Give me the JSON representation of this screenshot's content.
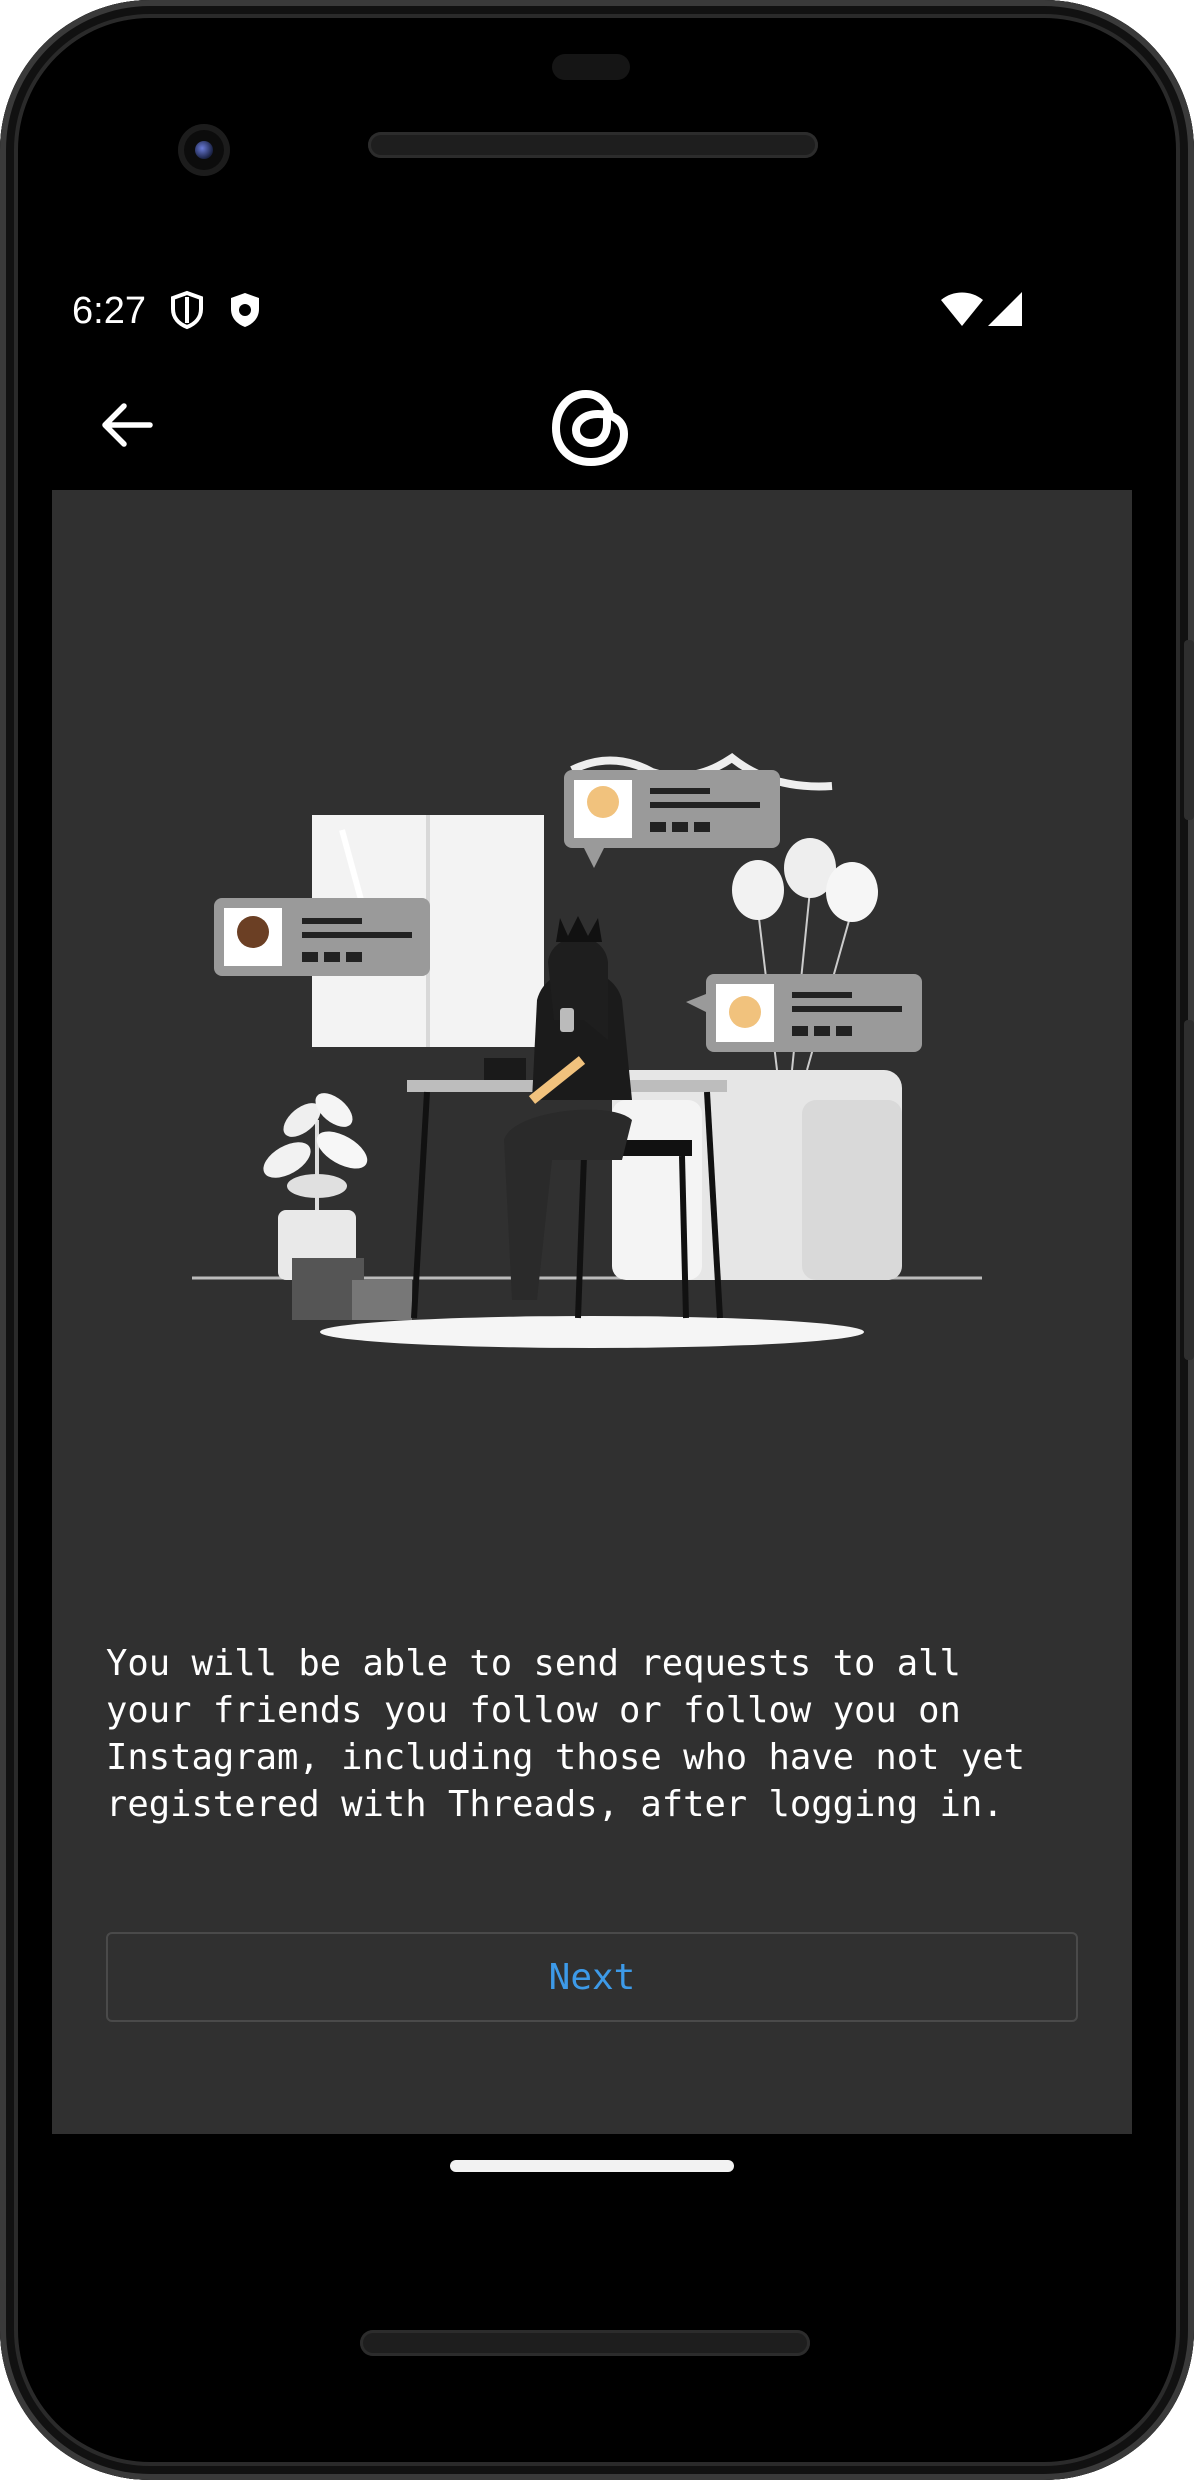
{
  "status_bar": {
    "time": "6:27",
    "left_icons": [
      "shield-outline-icon",
      "shield-check-icon"
    ],
    "right_icons": [
      "wifi-icon",
      "cellular-signal-icon"
    ]
  },
  "app_bar": {
    "back_icon": "arrow-left-icon",
    "logo_icon": "threads-logo-icon"
  },
  "main": {
    "illustration": "person-at-desk-with-chat-bubbles-illustration",
    "description": "You will be able to send requests to all\nyour friends you follow or follow you on\nInstagram, including those who have not yet\nregistered with Threads, after logging in.",
    "next_label": "Next"
  },
  "colors": {
    "background": "#303030",
    "text": "#ffffff",
    "accent": "#3d9ae8",
    "button_border": "#4a4a4a"
  }
}
